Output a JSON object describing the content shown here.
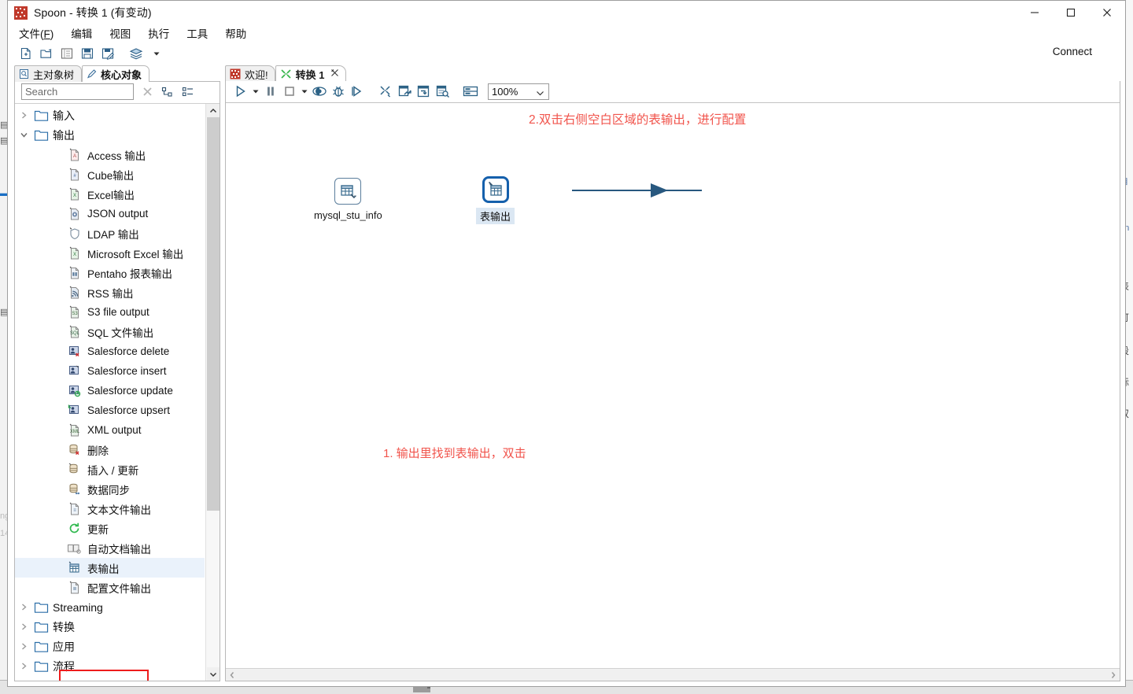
{
  "window": {
    "title": "Spoon - 转换 1 (有变动)",
    "icon": "spoon-app-icon",
    "minimize_label": "—",
    "maximize_label": "□",
    "close_label": "✕"
  },
  "menubar": {
    "items": [
      {
        "label": "文件(F)",
        "name": "menu-file"
      },
      {
        "label": "编辑",
        "name": "menu-edit"
      },
      {
        "label": "视图",
        "name": "menu-view"
      },
      {
        "label": "执行",
        "name": "menu-run"
      },
      {
        "label": "工具",
        "name": "menu-tools"
      },
      {
        "label": "帮助",
        "name": "menu-help"
      }
    ]
  },
  "toolbar": {
    "icons": [
      "new-file-icon",
      "open-folder-icon",
      "explorer-icon",
      "save-icon",
      "save-as-icon",
      "layers-icon",
      "chevron-down-icon"
    ],
    "connect_label": "Connect"
  },
  "left_panel": {
    "tabs": [
      {
        "label": "主对象树",
        "icon": "document-search-icon",
        "active": false
      },
      {
        "label": "核心对象",
        "icon": "pencil-icon",
        "active": true
      }
    ],
    "search": {
      "placeholder": "Search",
      "value": "",
      "clear_icon": "clear-x-icon",
      "expand_all_icon": "expand-tree-icon",
      "collapse_all_icon": "collapse-tree-icon"
    },
    "tree": [
      {
        "label": "输入",
        "type": "folder",
        "expanded": false,
        "icon": "folder-icon"
      },
      {
        "label": "输出",
        "type": "folder",
        "expanded": true,
        "icon": "folder-icon"
      },
      {
        "label": "Access 输出",
        "type": "leaf",
        "icon": "access-output-icon"
      },
      {
        "label": "Cube输出",
        "type": "leaf",
        "icon": "cube-output-icon"
      },
      {
        "label": "Excel输出",
        "type": "leaf",
        "icon": "excel-output-icon"
      },
      {
        "label": "JSON output",
        "type": "leaf",
        "icon": "json-output-icon"
      },
      {
        "label": "LDAP 输出",
        "type": "leaf",
        "icon": "ldap-shield-icon"
      },
      {
        "label": "Microsoft Excel 输出",
        "type": "leaf",
        "icon": "excel-output-icon"
      },
      {
        "label": "Pentaho 报表输出",
        "type": "leaf",
        "icon": "report-output-icon"
      },
      {
        "label": "RSS 输出",
        "type": "leaf",
        "icon": "rss-output-icon"
      },
      {
        "label": "S3 file output",
        "type": "leaf",
        "icon": "s3-output-icon"
      },
      {
        "label": "SQL 文件输出",
        "type": "leaf",
        "icon": "sql-file-output-icon"
      },
      {
        "label": "Salesforce delete",
        "type": "leaf",
        "icon": "salesforce-delete-icon"
      },
      {
        "label": "Salesforce insert",
        "type": "leaf",
        "icon": "salesforce-insert-icon"
      },
      {
        "label": "Salesforce update",
        "type": "leaf",
        "icon": "salesforce-update-icon"
      },
      {
        "label": "Salesforce upsert",
        "type": "leaf",
        "icon": "salesforce-upsert-icon"
      },
      {
        "label": "XML output",
        "type": "leaf",
        "icon": "xml-output-icon"
      },
      {
        "label": "删除",
        "type": "leaf",
        "icon": "database-delete-icon"
      },
      {
        "label": "插入 / 更新",
        "type": "leaf",
        "icon": "database-insert-update-icon"
      },
      {
        "label": "数据同步",
        "type": "leaf",
        "icon": "database-sync-icon"
      },
      {
        "label": "文本文件输出",
        "type": "leaf",
        "icon": "text-file-output-icon"
      },
      {
        "label": "更新",
        "type": "leaf",
        "icon": "refresh-update-icon"
      },
      {
        "label": "自动文档输出",
        "type": "leaf",
        "icon": "auto-doc-output-icon"
      },
      {
        "label": "表输出",
        "type": "leaf",
        "icon": "table-output-icon",
        "highlighted": true
      },
      {
        "label": "配置文件输出",
        "type": "leaf",
        "icon": "properties-output-icon"
      },
      {
        "label": "Streaming",
        "type": "folder",
        "expanded": false,
        "icon": "folder-icon"
      },
      {
        "label": "转换",
        "type": "folder",
        "expanded": false,
        "icon": "folder-icon"
      },
      {
        "label": "应用",
        "type": "folder",
        "expanded": false,
        "icon": "folder-icon"
      },
      {
        "label": "流程",
        "type": "folder",
        "expanded": false,
        "icon": "folder-icon"
      }
    ],
    "scrollbar": {
      "up_icon": "chevron-up-icon",
      "down_icon": "chevron-down-icon"
    }
  },
  "right_panel": {
    "tabs": [
      {
        "label": "欢迎!",
        "icon": "spoon-welcome-icon",
        "active": false,
        "closable": false
      },
      {
        "label": "转换 1",
        "icon": "transformation-icon",
        "active": true,
        "closable": true,
        "close_icon": "close-x-icon"
      }
    ],
    "canvas_toolbar": {
      "icons": [
        "run-play-icon",
        "chevron-down-icon",
        "pause-icon",
        "stop-icon",
        "chevron-down-icon",
        "preview-eye-icon",
        "debug-bug-icon",
        "run-step-icon",
        "hide-step-icon",
        "show-impact-icon",
        "sql-generate-icon",
        "database-explore-icon",
        "grid-rows-icon"
      ],
      "zoom": {
        "value": "100%",
        "caret_icon": "chevron-down-icon"
      }
    },
    "canvas": {
      "annotations": [
        {
          "id": "annotation-2",
          "text": "2.双击右侧空白区域的表输出，进行配置",
          "color": "#f1544c"
        },
        {
          "id": "annotation-1",
          "text": "1. 输出里找到表输出，双击",
          "color": "#f1544c"
        }
      ],
      "steps": [
        {
          "name": "table-input-step",
          "label": "mysql_stu_info",
          "icon": "table-input-icon",
          "selected": false
        },
        {
          "name": "table-output-step",
          "label": "表输出",
          "icon": "table-output-icon",
          "selected": true
        }
      ],
      "hop": {
        "from": "mysql_stu_info",
        "to": "表输出",
        "color": "#28587f"
      }
    },
    "hscroll": {
      "left_icon": "chevron-left-icon",
      "right_icon": "chevron-right-icon"
    }
  }
}
